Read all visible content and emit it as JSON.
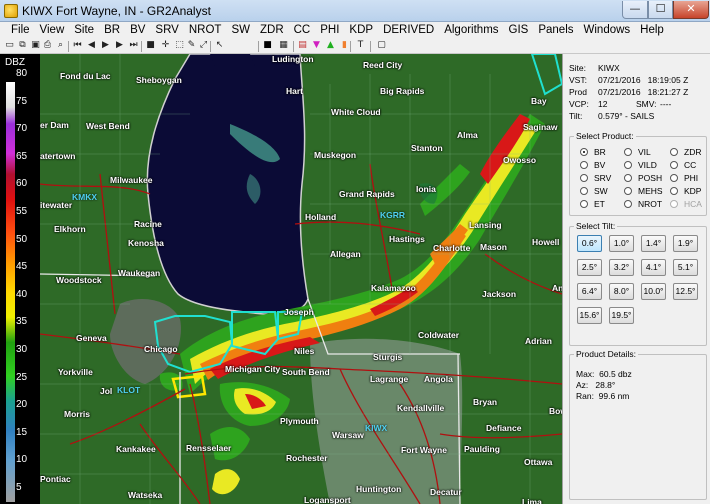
{
  "window": {
    "title": "KIWX Fort Wayne, IN - GR2Analyst"
  },
  "menu": [
    "File",
    "View",
    "Site",
    "BR",
    "BV",
    "SRV",
    "NROT",
    "SW",
    "ZDR",
    "CC",
    "PHI",
    "KDP",
    "DERIVED",
    "Algorithms",
    "GIS",
    "Panels",
    "Windows",
    "Help"
  ],
  "toolbar_icons": [
    "open-icon",
    "copy-icon",
    "save-icon",
    "print-icon",
    "zoom-icon",
    "first-frame-icon",
    "prev-frame-icon",
    "play-icon",
    "next-frame-icon",
    "last-frame-icon",
    "stop-icon",
    "crosshair-icon",
    "placefile-icon",
    "tool-icon",
    "measure-icon",
    "pointer-icon",
    "black-square-icon",
    "grid-icon",
    "color-table-icon",
    "magenta-triangle-icon",
    "green-triangle-icon",
    "orange-rect-icon",
    "text-tool-icon",
    "window-icon"
  ],
  "scale": {
    "unit": "DBZ",
    "labels": [
      "80",
      "75",
      "70",
      "65",
      "60",
      "55",
      "50",
      "45",
      "40",
      "35",
      "30",
      "25",
      "20",
      "15",
      "10",
      "5"
    ]
  },
  "site_info": {
    "site_label": "Site:",
    "site_value": "KIWX",
    "vst_label": "VST:",
    "vst_value": "07/21/2016   18:19:05 Z",
    "prod_label": "Prod",
    "prod_value": "07/21/2016   18:21:27 Z",
    "vcp_label": "VCP:",
    "vcp_value": "12",
    "smv_label": "SMV:",
    "smv_value": "----",
    "tilt_label": "Tilt:",
    "tilt_value": "0.579° - SAILS"
  },
  "select_product": {
    "title": "Select Product:",
    "options": [
      {
        "label": "BR",
        "selected": true,
        "disabled": false
      },
      {
        "label": "VIL",
        "selected": false,
        "disabled": false
      },
      {
        "label": "ZDR",
        "selected": false,
        "disabled": false
      },
      {
        "label": "BV",
        "selected": false,
        "disabled": false
      },
      {
        "label": "VILD",
        "selected": false,
        "disabled": false
      },
      {
        "label": "CC",
        "selected": false,
        "disabled": false
      },
      {
        "label": "SRV",
        "selected": false,
        "disabled": false
      },
      {
        "label": "POSH",
        "selected": false,
        "disabled": false
      },
      {
        "label": "PHI",
        "selected": false,
        "disabled": false
      },
      {
        "label": "SW",
        "selected": false,
        "disabled": false
      },
      {
        "label": "MEHS",
        "selected": false,
        "disabled": false
      },
      {
        "label": "KDP",
        "selected": false,
        "disabled": false
      },
      {
        "label": "ET",
        "selected": false,
        "disabled": false
      },
      {
        "label": "NROT",
        "selected": false,
        "disabled": false
      },
      {
        "label": "HCA",
        "selected": false,
        "disabled": true
      }
    ]
  },
  "select_tilt": {
    "title": "Select Tilt:",
    "tilts": [
      "0.6°",
      "1.0°",
      "1.4°",
      "1.9°",
      "2.5°",
      "3.2°",
      "4.1°",
      "5.1°",
      "6.4°",
      "8.0°",
      "10.0°",
      "12.5°",
      "15.6°",
      "19.5°"
    ],
    "active": "0.6°"
  },
  "product_details": {
    "title": "Product Details:",
    "max": "Max:  60.5 dbz",
    "az": "Az:   28.8°",
    "ran": "Ran:  99.6 nm"
  },
  "map": {
    "cities": [
      "Fond du Lac",
      "Sheboygan",
      "West Bend",
      "er Dam",
      "atertown",
      "Milwaukee",
      "itewater",
      "Racine",
      "Elkhorn",
      "Kenosha",
      "Woodstock",
      "Waukegan",
      "Geneva",
      "Chicago",
      "Yorkville",
      "Jol",
      "Morris",
      "Kankakee",
      "Pontiac",
      "Watseka",
      "Rensselaer",
      "Ludington",
      "Reed City",
      "Hart",
      "Big Rapids",
      "White Cloud",
      "Muskegon",
      "Alma",
      "Saginaw",
      "Stanton",
      "Grand Rapids",
      "Ionia",
      "Owosso",
      "Holland",
      "Lansing",
      "Allegan",
      "Hastings",
      "Charlotte",
      "Mason",
      "Howell",
      "Kalamazoo",
      "Jackson",
      "Ann",
      "Joseph",
      "Coldwater",
      "Niles",
      "Sturgis",
      "Adrian",
      "Michigan City",
      "South Bend",
      "Lagrange",
      "Angola",
      "Plymouth",
      "Kendallville",
      "Bryan",
      "Warsaw",
      "Defiance",
      "Rochester",
      "Fort Wayne",
      "Paulding",
      "Ottawa",
      "Huntington",
      "Decatur",
      "Logansport",
      "Lima",
      "Bay",
      "Bow"
    ],
    "sites": [
      "KMKX",
      "KGRR",
      "KLOT",
      "KIWX"
    ]
  }
}
